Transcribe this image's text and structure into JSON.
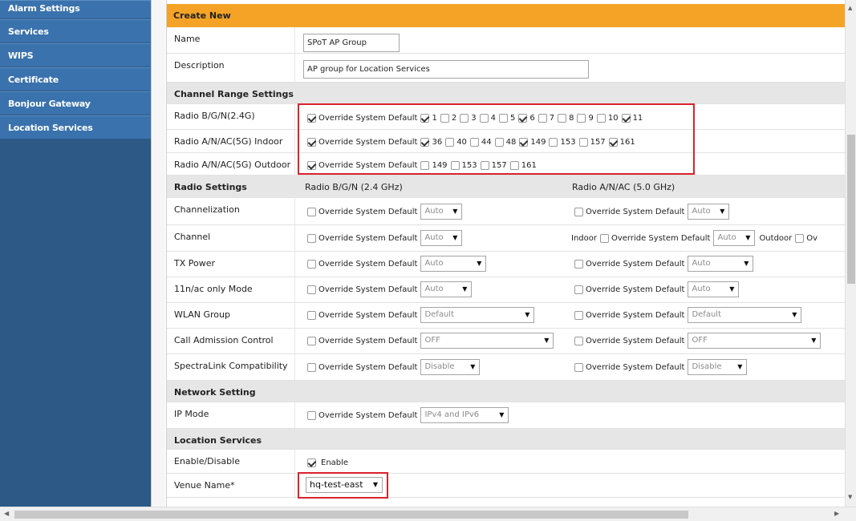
{
  "nav": {
    "items": [
      {
        "label": "Alarm Settings"
      },
      {
        "label": "Services"
      },
      {
        "label": "WIPS"
      },
      {
        "label": "Certificate"
      },
      {
        "label": "Bonjour Gateway"
      },
      {
        "label": "Location Services"
      }
    ]
  },
  "form": {
    "header": "Create New",
    "name_label": "Name",
    "name_value": "SPoT AP Group",
    "description_label": "Description",
    "description_value": "AP group for Location Services",
    "channel_range_section": "Channel Range Settings",
    "radio_24_label": "Radio B/G/N(2.4G)",
    "radio_5g_in_label": "Radio A/N/AC(5G) Indoor",
    "radio_5g_out_label": "Radio A/N/AC(5G) Outdoor",
    "override_label": "Override System Default",
    "radio_24_channels": [
      {
        "ch": "1",
        "checked": true
      },
      {
        "ch": "2",
        "checked": false
      },
      {
        "ch": "3",
        "checked": false
      },
      {
        "ch": "4",
        "checked": false
      },
      {
        "ch": "5",
        "checked": false
      },
      {
        "ch": "6",
        "checked": true
      },
      {
        "ch": "7",
        "checked": false
      },
      {
        "ch": "8",
        "checked": false
      },
      {
        "ch": "9",
        "checked": false
      },
      {
        "ch": "10",
        "checked": false
      },
      {
        "ch": "11",
        "checked": true
      }
    ],
    "radio_5g_in_channels": [
      {
        "ch": "36",
        "checked": true
      },
      {
        "ch": "40",
        "checked": false
      },
      {
        "ch": "44",
        "checked": false
      },
      {
        "ch": "48",
        "checked": false
      },
      {
        "ch": "149",
        "checked": true
      },
      {
        "ch": "153",
        "checked": false
      },
      {
        "ch": "157",
        "checked": false
      },
      {
        "ch": "161",
        "checked": true
      }
    ],
    "radio_5g_out_channels": [
      {
        "ch": "149",
        "checked": false
      },
      {
        "ch": "153",
        "checked": false
      },
      {
        "ch": "157",
        "checked": false
      },
      {
        "ch": "161",
        "checked": false
      }
    ],
    "radio_settings_section": "Radio Settings",
    "col_24_header": "Radio B/G/N (2.4 GHz)",
    "col_5_header": "Radio A/N/AC (5.0 GHz)",
    "channelization_label": "Channelization",
    "channel_label": "Channel",
    "tx_power_label": "TX Power",
    "only_mode_label": "11n/ac only Mode",
    "wlan_group_label": "WLAN Group",
    "cac_label": "Call Admission Control",
    "spectralink_label": "SpectraLink Compatibility",
    "auto": "Auto",
    "default": "Default",
    "off": "OFF",
    "disable": "Disable",
    "indoor": "Indoor",
    "outdoor": "Outdoor",
    "ov_truncated": "Ov",
    "network_section": "Network Setting",
    "ip_mode_label": "IP Mode",
    "ip_mode_value": "IPv4 and IPv6",
    "location_section": "Location Services",
    "enable_disable_label": "Enable/Disable",
    "enable_label": "Enable",
    "venue_label": "Venue Name*",
    "venue_value": "hq-test-east"
  },
  "colors": {
    "nav_bg": "#2c5986",
    "nav_item": "#3a72ad",
    "header_orange": "#f4a327",
    "section_gray": "#e6e6e6",
    "highlight_red": "#d9232d"
  }
}
